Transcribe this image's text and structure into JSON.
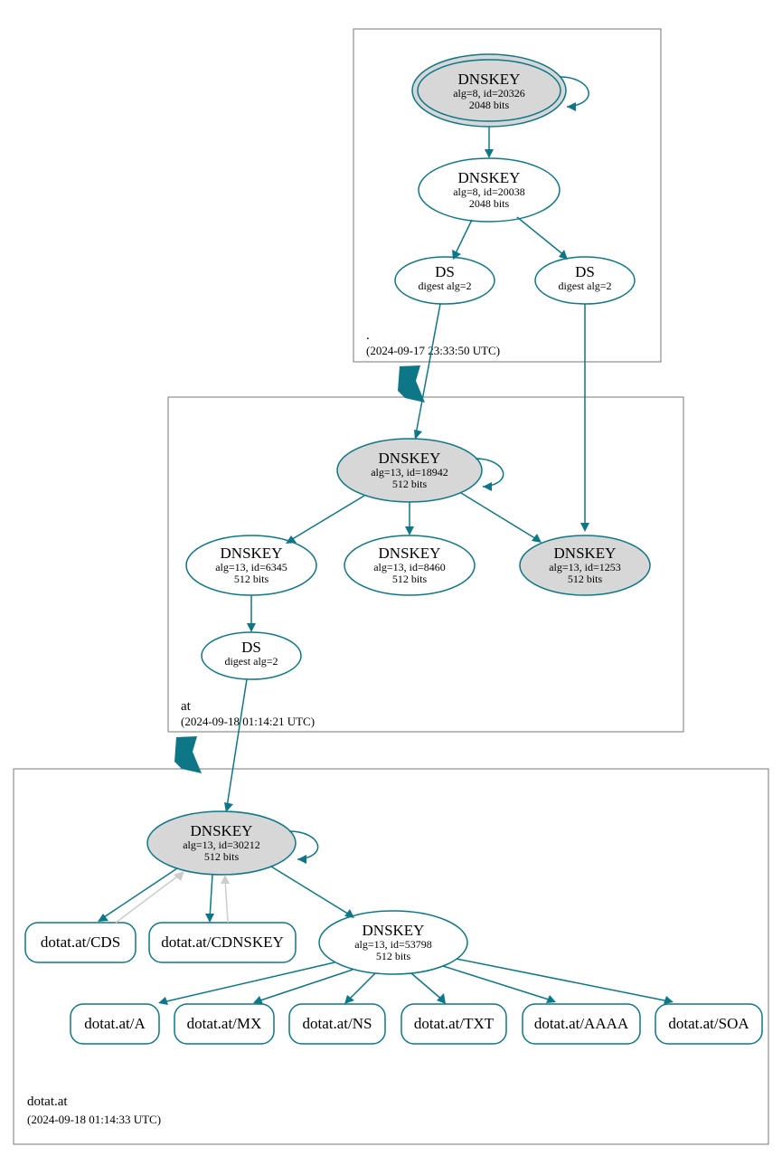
{
  "chart_data": {
    "type": "dnssec-chain",
    "zones": [
      {
        "name": ".",
        "time": "(2024-09-17 23:33:50 UTC)",
        "nodes": [
          "root-ksk",
          "root-zsk",
          "root-ds1",
          "root-ds2"
        ]
      },
      {
        "name": "at",
        "time": "(2024-09-18 01:14:21 UTC)",
        "nodes": [
          "at-ksk",
          "at-zsk1",
          "at-zsk2",
          "at-zsk3",
          "at-ds"
        ]
      },
      {
        "name": "dotat.at",
        "time": "(2024-09-18 01:14:33 UTC)",
        "nodes": [
          "dotat-ksk",
          "dotat-zsk",
          "rr-cds",
          "rr-cdnskey",
          "rr-a",
          "rr-mx",
          "rr-ns",
          "rr-txt",
          "rr-aaaa",
          "rr-soa"
        ]
      }
    ]
  },
  "nodes": {
    "root-ksk": {
      "title": "DNSKEY",
      "sub1": "alg=8, id=20326",
      "sub2": "2048 bits"
    },
    "root-zsk": {
      "title": "DNSKEY",
      "sub1": "alg=8, id=20038",
      "sub2": "2048 bits"
    },
    "root-ds1": {
      "title": "DS",
      "sub1": "digest alg=2"
    },
    "root-ds2": {
      "title": "DS",
      "sub1": "digest alg=2"
    },
    "at-ksk": {
      "title": "DNSKEY",
      "sub1": "alg=13, id=18942",
      "sub2": "512 bits"
    },
    "at-zsk1": {
      "title": "DNSKEY",
      "sub1": "alg=13, id=6345",
      "sub2": "512 bits"
    },
    "at-zsk2": {
      "title": "DNSKEY",
      "sub1": "alg=13, id=8460",
      "sub2": "512 bits"
    },
    "at-zsk3": {
      "title": "DNSKEY",
      "sub1": "alg=13, id=1253",
      "sub2": "512 bits"
    },
    "at-ds": {
      "title": "DS",
      "sub1": "digest alg=2"
    },
    "dotat-ksk": {
      "title": "DNSKEY",
      "sub1": "alg=13, id=30212",
      "sub2": "512 bits"
    },
    "dotat-zsk": {
      "title": "DNSKEY",
      "sub1": "alg=13, id=53798",
      "sub2": "512 bits"
    },
    "rr-cds": {
      "label": "dotat.at/CDS"
    },
    "rr-cdnskey": {
      "label": "dotat.at/CDNSKEY"
    },
    "rr-a": {
      "label": "dotat.at/A"
    },
    "rr-mx": {
      "label": "dotat.at/MX"
    },
    "rr-ns": {
      "label": "dotat.at/NS"
    },
    "rr-txt": {
      "label": "dotat.at/TXT"
    },
    "rr-aaaa": {
      "label": "dotat.at/AAAA"
    },
    "rr-soa": {
      "label": "dotat.at/SOA"
    }
  },
  "zoneLabels": {
    "root": {
      "name": ".",
      "time": "(2024-09-17 23:33:50 UTC)"
    },
    "at": {
      "name": "at",
      "time": "(2024-09-18 01:14:21 UTC)"
    },
    "dotat": {
      "name": "dotat.at",
      "time": "(2024-09-18 01:14:33 UTC)"
    }
  }
}
